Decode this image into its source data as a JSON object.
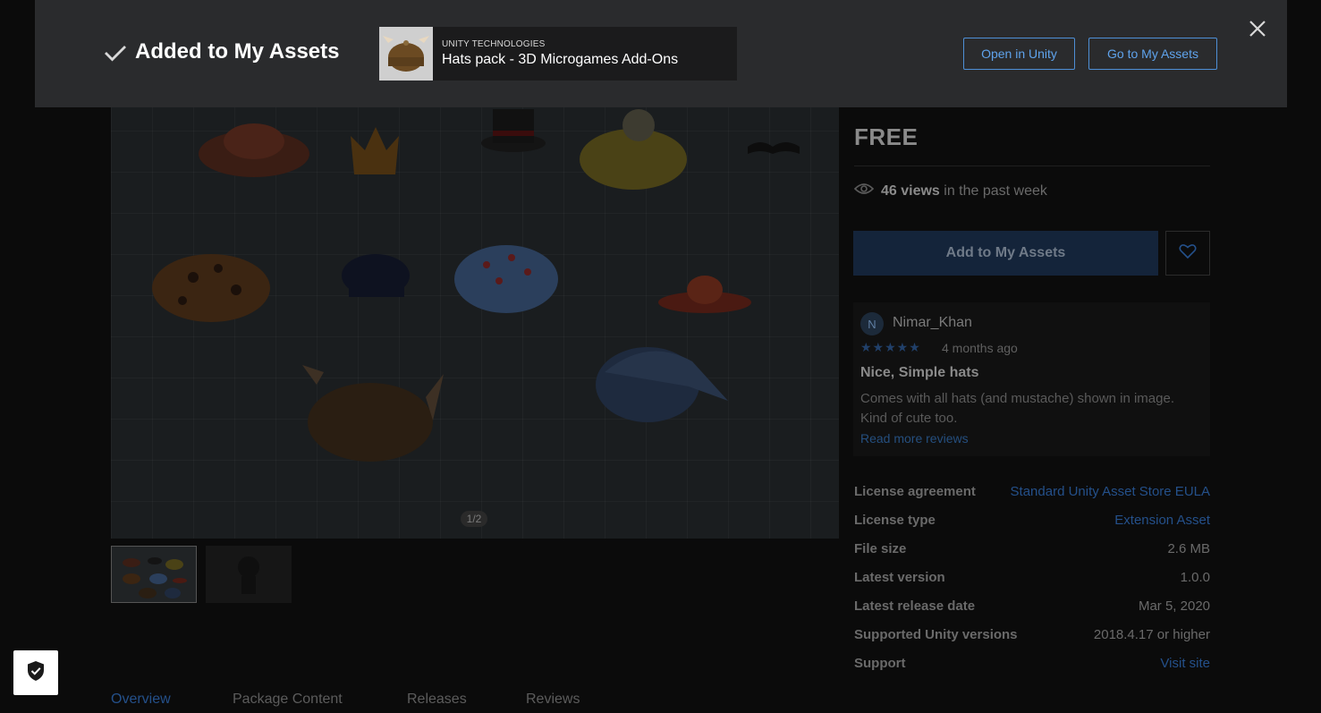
{
  "banner": {
    "title": "Added to My Assets",
    "asset_publisher": "UNITY TECHNOLOGIES",
    "asset_name": "Hats pack - 3D Microgames Add-Ons",
    "open_in_unity_label": "Open in Unity",
    "go_to_my_assets_label": "Go to My Assets"
  },
  "gallery": {
    "counter": "1/2"
  },
  "product": {
    "price": "FREE",
    "views_count": "46 views",
    "views_suffix": "in the past week",
    "add_button_label": "Add to My Assets"
  },
  "review": {
    "avatar_initial": "N",
    "reviewer": "Nimar_Khan",
    "stars": "★★★★★",
    "rating": 5,
    "date": "4 months ago",
    "title": "Nice, Simple hats",
    "body": "Comes with all hats (and mustache) shown in image. Kind of cute too.",
    "read_more": "Read more reviews"
  },
  "info": [
    {
      "label": "License agreement",
      "value": "Standard Unity Asset Store EULA"
    },
    {
      "label": "License type",
      "value": "Extension Asset"
    },
    {
      "label": "File size",
      "value": "2.6 MB"
    },
    {
      "label": "Latest version",
      "value": "1.0.0"
    },
    {
      "label": "Latest release date",
      "value": "Mar 5, 2020"
    },
    {
      "label": "Supported Unity versions",
      "value": "2018.4.17 or higher"
    },
    {
      "label": "Support",
      "value": "Visit site"
    }
  ],
  "tabs": [
    "Overview",
    "Package Content",
    "Releases",
    "Reviews"
  ],
  "colors": {
    "accent": "#4e8fd6",
    "banner_bg": "#2a2b2d"
  }
}
